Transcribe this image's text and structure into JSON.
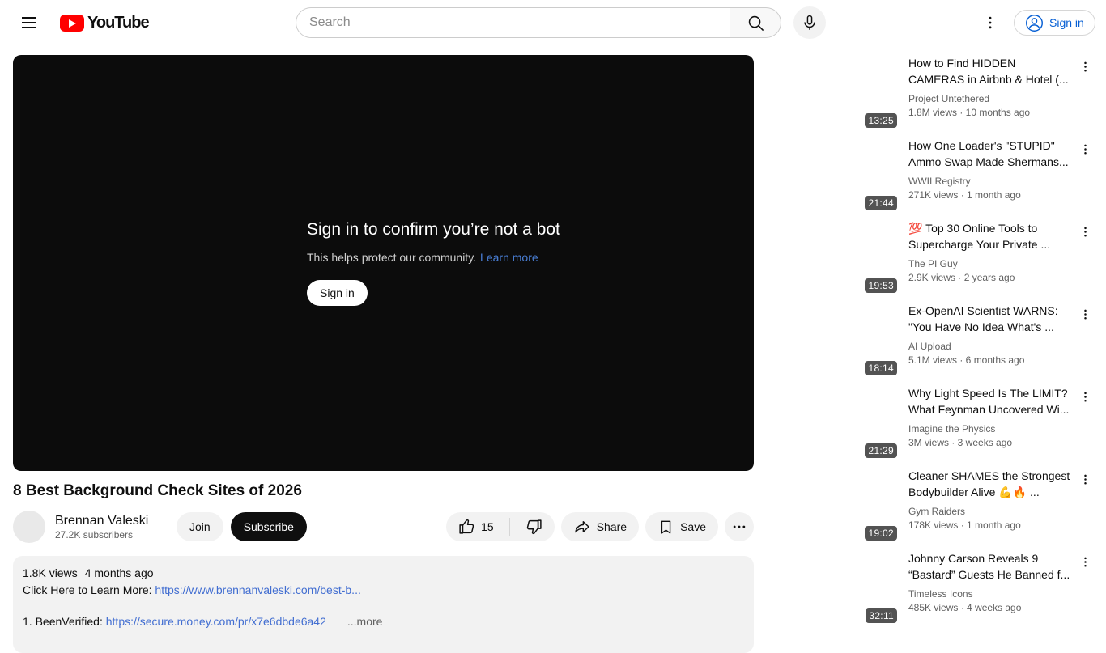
{
  "header": {
    "logo_text": "YouTube",
    "search_placeholder": "Search",
    "signin_label": "Sign in"
  },
  "player": {
    "headline": "Sign in to confirm you’re not a bot",
    "subtext": "This helps protect our community.",
    "learn_more_label": "Learn more",
    "signin_button_label": "Sign in"
  },
  "video": {
    "title": "8 Best Background Check Sites of 2026",
    "channel_name": "Brennan Valeski",
    "subscribers": "27.2K subscribers",
    "join_label": "Join",
    "subscribe_label": "Subscribe",
    "like_count": "15",
    "share_label": "Share",
    "save_label": "Save"
  },
  "description": {
    "views": "1.8K views",
    "age": "4 months ago",
    "line1_prefix": "Click Here to Learn More: ",
    "line1_link": "https://www.brennanvaleski.com/best-b...",
    "line2_prefix": "1. BeenVerified: ",
    "line2_link": "https://secure.money.com/pr/x7e6dbde6a42",
    "more_label": "...more"
  },
  "sidebar": {
    "items": [
      {
        "title": "How to Find HIDDEN CAMERAS in Airbnb & Hotel (...",
        "channel": "Project Untethered",
        "meta": "1.8M views · 10 months ago",
        "duration": "13:25"
      },
      {
        "title": "How One Loader's \"STUPID\" Ammo Swap Made Shermans...",
        "channel": "WWII Registry",
        "meta": "271K views · 1 month ago",
        "duration": "21:44"
      },
      {
        "title": "💯 Top 30 Online Tools to Supercharge Your Private ...",
        "channel": "The PI Guy",
        "meta": "2.9K views · 2 years ago",
        "duration": "19:53"
      },
      {
        "title": "Ex-OpenAI Scientist WARNS: \"You Have No Idea What's ...",
        "channel": "AI Upload",
        "meta": "5.1M views · 6 months ago",
        "duration": "18:14"
      },
      {
        "title": "Why Light Speed Is The LIMIT? What Feynman Uncovered Wi...",
        "channel": "Imagine the Physics",
        "meta": "3M views · 3 weeks ago",
        "duration": "21:29"
      },
      {
        "title": "Cleaner SHAMES the Strongest Bodybuilder Alive 💪🔥  ...",
        "channel": "Gym Raiders",
        "meta": "178K views · 1 month ago",
        "duration": "19:02"
      },
      {
        "title": "Johnny Carson Reveals 9 “Bastard” Guests He Banned f...",
        "channel": "Timeless Icons",
        "meta": "485K views · 4 weeks ago",
        "duration": "32:11"
      }
    ]
  },
  "colors": {
    "brand_red": "#ff0000",
    "signin_blue": "#065fd4",
    "description_link_blue": "#426ed1",
    "player_link_blue": "#4a7fd6",
    "surface_gray": "#f2f2f2",
    "secondary_text": "#606060",
    "player_black": "#0c0c0c"
  },
  "icons": {
    "menu-icon": "hamburger ☰",
    "youtube-play-icon": "red rounded rect + white triangle",
    "search-icon": "magnifier",
    "mic-icon": "microphone",
    "kebab-menu-icon": "vertical dots ⋮",
    "person-icon": "person in circle",
    "like-icon": "thumb up outline",
    "dislike-icon": "thumb down outline",
    "share-icon": "bent arrow",
    "save-icon": "bookmark outline",
    "more-horizontal-icon": "•••"
  }
}
